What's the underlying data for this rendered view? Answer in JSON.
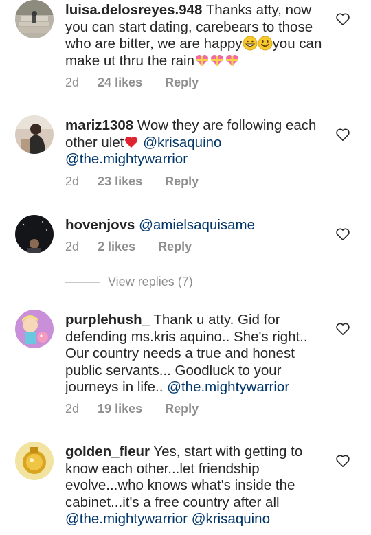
{
  "comments": [
    {
      "username": "luisa.delosreyes.948",
      "text_parts": [
        "Thanks atty, now you can start dating, carebears to those who are bitter, we are happy",
        "you can make ut thru the rain"
      ],
      "time": "2d",
      "likes": "24 likes",
      "reply": "Reply",
      "avatar_icon": "avatar-photo-stairs-icon"
    },
    {
      "username": "mariz1308",
      "text": "Wow they are following each other ulet",
      "mentions": [
        "@krisaquino",
        "@the.mightywarrior"
      ],
      "time": "2d",
      "likes": "23 likes",
      "reply": "Reply",
      "avatar_icon": "avatar-photo-person-icon"
    },
    {
      "username": "hovenjovs",
      "mentions": [
        "@amielsaquisame"
      ],
      "time": "2d",
      "likes": "2 likes",
      "reply": "Reply",
      "avatar_icon": "avatar-photo-dark-icon",
      "view_replies": "View replies (7)"
    },
    {
      "username": "purplehush_",
      "text": "Thank u atty. Gid for defending ms.kris aquino.. She's right.. Our country needs a true and honest public servants... Goodluck to your journeys in life..",
      "mentions": [
        "@the.mightywarrior"
      ],
      "time": "2d",
      "likes": "19 likes",
      "reply": "Reply",
      "avatar_icon": "avatar-cartoon-icon"
    },
    {
      "username": "golden_fleur",
      "text": "Yes, start with getting to know each other...let friendship evolve...who knows what's inside the cabinet...it's a free country after all",
      "mentions": [
        "@the.mightywarrior",
        "@krisaquino"
      ],
      "avatar_icon": "avatar-gold-icon"
    }
  ],
  "colors": {
    "text": "#262626",
    "meta": "#8e8e8e",
    "mention": "#003569",
    "heart_outline": "#262626"
  }
}
